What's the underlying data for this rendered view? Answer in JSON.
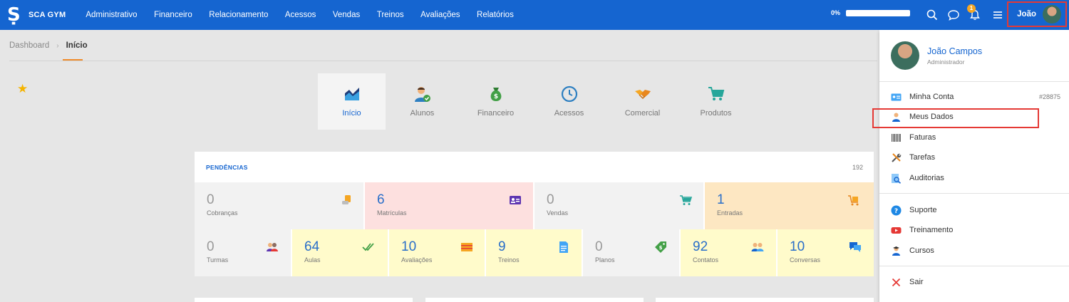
{
  "app": {
    "logo_mark": "Ṣ",
    "name": "SCA GYM"
  },
  "nav": [
    "Administrativo",
    "Financeiro",
    "Relacionamento",
    "Acessos",
    "Vendas",
    "Treinos",
    "Avaliações",
    "Relatórios"
  ],
  "progress": {
    "label": "0%",
    "value": 0
  },
  "notifications": {
    "count": "1"
  },
  "user": {
    "short_name": "João",
    "full_name": "João Campos",
    "role": "Administrador"
  },
  "breadcrumb": {
    "parent": "Dashboard",
    "separator": "›",
    "current": "Início"
  },
  "modules": [
    {
      "label": "Início",
      "icon": "chart-area-icon",
      "active": true
    },
    {
      "label": "Alunos",
      "icon": "student-check-icon",
      "active": false
    },
    {
      "label": "Financeiro",
      "icon": "money-bag-icon",
      "active": false
    },
    {
      "label": "Acessos",
      "icon": "clock-icon",
      "active": false
    },
    {
      "label": "Comercial",
      "icon": "handshake-icon",
      "active": false
    },
    {
      "label": "Produtos",
      "icon": "cart-icon",
      "active": false
    }
  ],
  "pendencias": {
    "title": "PENDÊNCIAS",
    "total": "192",
    "row1": [
      {
        "value": "0",
        "label": "Cobranças",
        "icon": "coins-icon"
      },
      {
        "value": "6",
        "label": "Matrículas",
        "icon": "id-card-icon"
      },
      {
        "value": "0",
        "label": "Vendas",
        "icon": "cart-icon"
      },
      {
        "value": "1",
        "label": "Entradas",
        "icon": "cart-box-icon"
      }
    ],
    "row2": [
      {
        "value": "0",
        "label": "Turmas",
        "icon": "group-icon"
      },
      {
        "value": "64",
        "label": "Aulas",
        "icon": "double-check-icon"
      },
      {
        "value": "10",
        "label": "Avaliações",
        "icon": "form-icon"
      },
      {
        "value": "9",
        "label": "Treinos",
        "icon": "document-icon"
      },
      {
        "value": "0",
        "label": "Planos",
        "icon": "tag-money-icon"
      },
      {
        "value": "92",
        "label": "Contatos",
        "icon": "contacts-icon"
      },
      {
        "value": "10",
        "label": "Conversas",
        "icon": "chat-bubbles-icon"
      }
    ]
  },
  "menu": {
    "account": {
      "label": "Minha Conta",
      "extra": "#28875"
    },
    "items1": [
      "Meus Dados",
      "Faturas",
      "Tarefas",
      "Auditorias"
    ],
    "items2": [
      "Suporte",
      "Treinamento",
      "Cursos"
    ],
    "logout": "Sair"
  },
  "colors": {
    "primary": "#1565d0",
    "accent": "#f08c2b",
    "highlight": "#e53935"
  }
}
